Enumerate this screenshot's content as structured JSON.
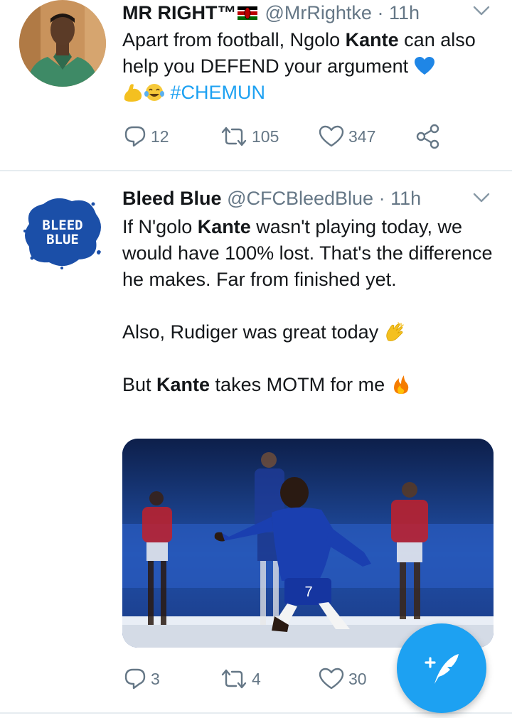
{
  "tweets": [
    {
      "display_name": "MR RIGHT™",
      "handle": "@MrRightke",
      "separator": "·",
      "time": "11h",
      "text": {
        "line1_pre": "Apart from football, Ngolo ",
        "line1_bold": "Kante",
        "line1_post": " can also help you DEFEND your argument ",
        "hashtag": "#CHEMUN"
      },
      "stats": {
        "replies": "12",
        "retweets": "105",
        "likes": "347"
      }
    },
    {
      "display_name": "Bleed Blue",
      "handle": "@CFCBleedBlue",
      "separator": "·",
      "time": "11h",
      "avatar_text": [
        "BLEED",
        "BLUE"
      ],
      "text": {
        "p1_pre": "If N'golo ",
        "p1_bold": "Kante",
        "p1_post": " wasn't playing today, we would have 100% lost. That's the difference he makes. Far from finished yet.",
        "p2": "Also, Rudiger was great today ",
        "p3_pre": "But ",
        "p3_bold": "Kante",
        "p3_post": " takes MOTM for me "
      },
      "stats": {
        "replies": "3",
        "retweets": "4",
        "likes": "30"
      }
    }
  ],
  "icons": {
    "reply": "reply-icon",
    "retweet": "retweet-icon",
    "like": "heart-icon",
    "share": "share-icon",
    "more": "chevron-down-icon",
    "compose": "compose-tweet-icon"
  },
  "colors": {
    "accent": "#1da1f2",
    "secondary_text": "#657786",
    "primary_text": "#14171a",
    "divider": "#e6ecf0"
  }
}
